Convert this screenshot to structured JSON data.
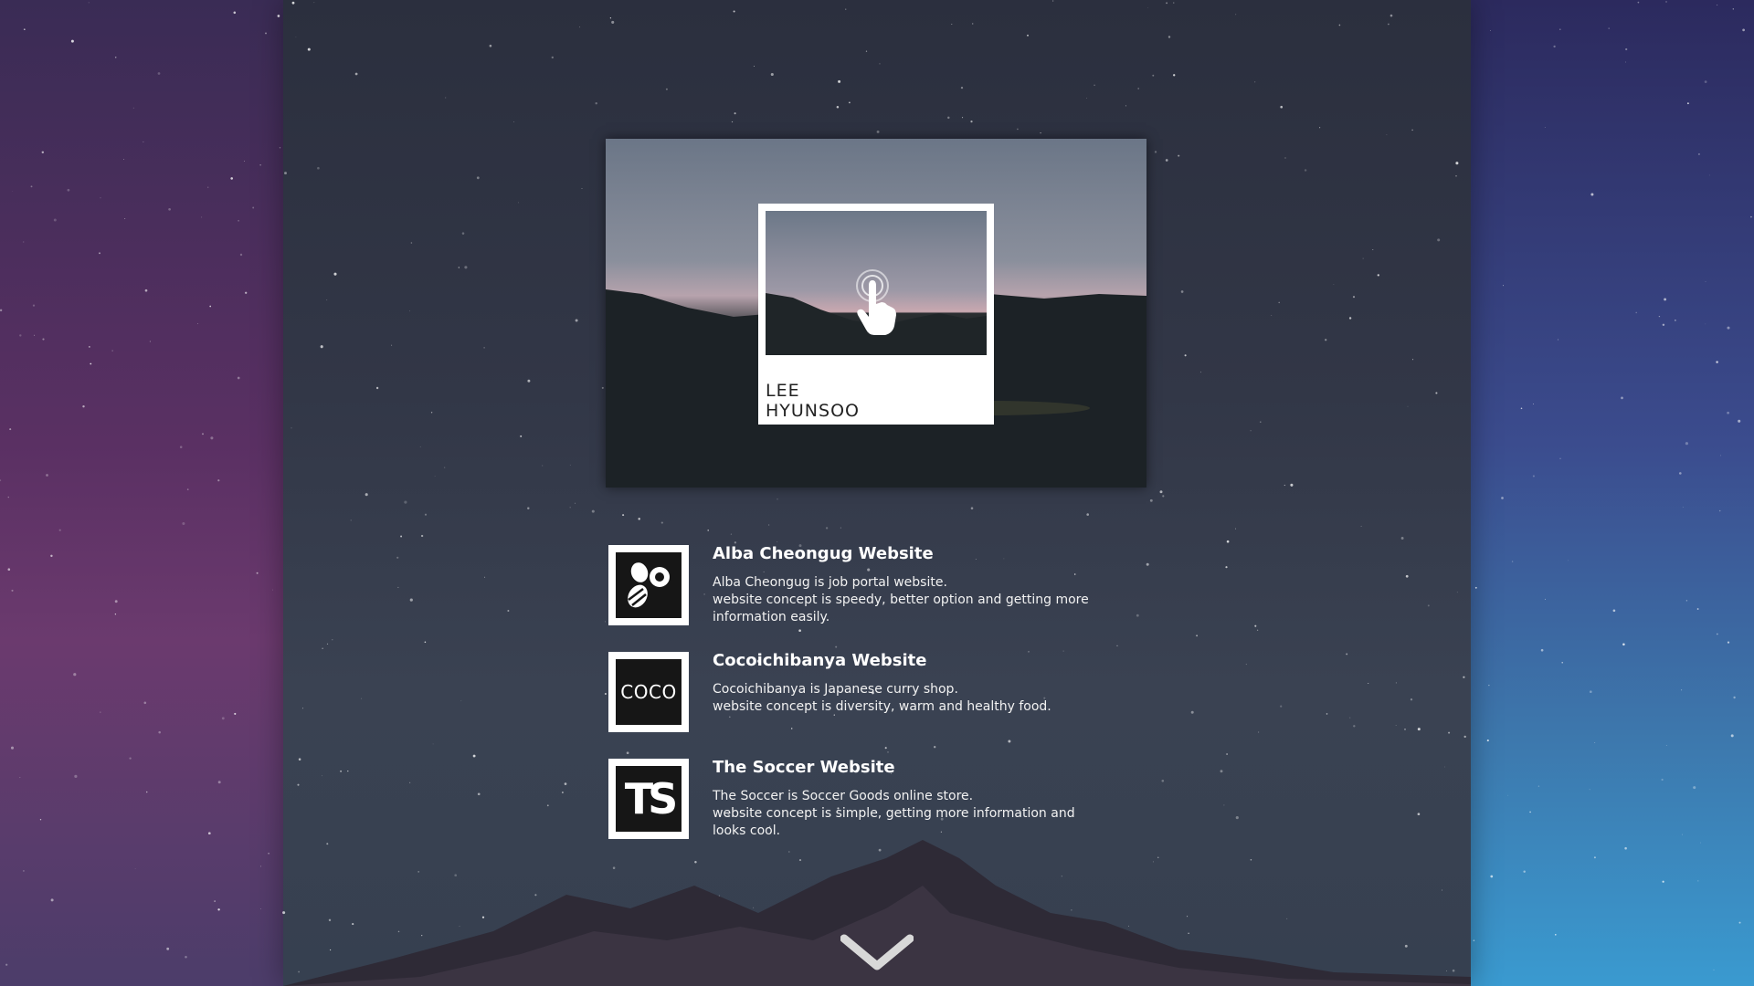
{
  "hero": {
    "name_line1": "LEE",
    "name_line2": "HYUNSOO"
  },
  "projects": [
    {
      "title": "Alba Cheongug Website",
      "desc_lines": [
        "Alba Cheongug is job portal website.",
        "website concept is speedy, better option and getting more",
        "information easily."
      ],
      "logo_icon": "alba-logo-icon"
    },
    {
      "title": "Cocoichibanya Website",
      "desc_lines": [
        "Cocoichibanya is Japanese curry shop.",
        "website concept is diversity, warm and healthy food."
      ],
      "logo_text": "COCO"
    },
    {
      "title": "The Soccer Website",
      "desc_lines": [
        "The Soccer is Soccer Goods online store.",
        "website concept is simple, getting more information and",
        "looks cool."
      ],
      "logo_text": "TS"
    }
  ],
  "scroll_icon": "chevron-down-icon",
  "colors": {
    "logo_border": "#ffffff",
    "logo_bg": "#161616",
    "text": "#ffffff"
  }
}
